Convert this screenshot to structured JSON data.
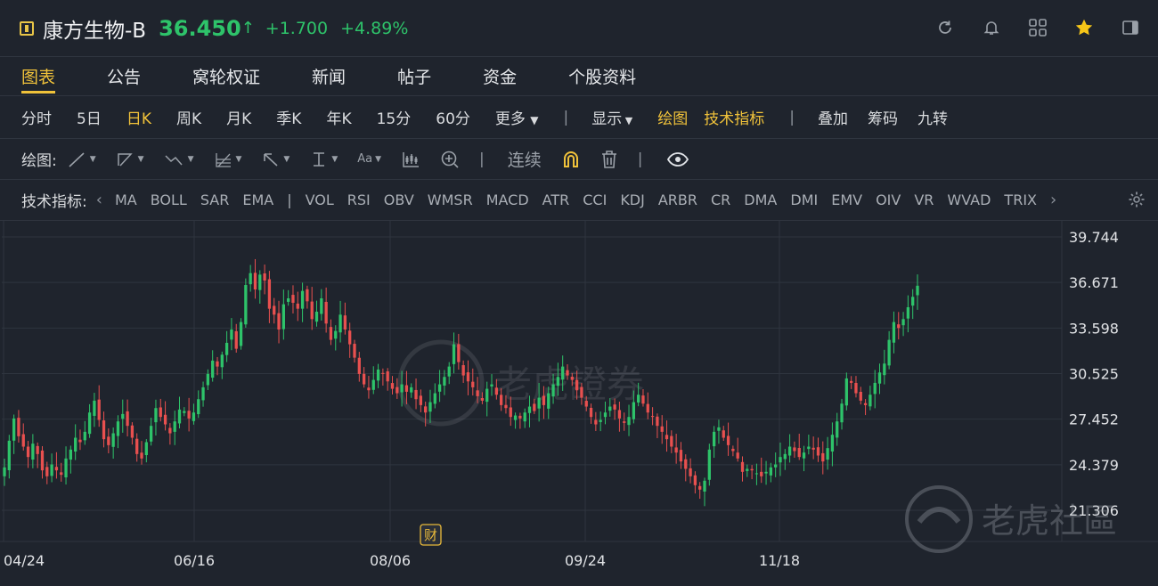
{
  "header": {
    "title": "康方生物-B",
    "price": "36.450",
    "arrow": "↑",
    "change": "+1.700",
    "change_pct": "+4.89%"
  },
  "tabs": [
    "图表",
    "公告",
    "窝轮权证",
    "新闻",
    "帖子",
    "资金",
    "个股资料"
  ],
  "periods": {
    "items": [
      "分时",
      "5日",
      "日K",
      "周K",
      "月K",
      "季K",
      "年K",
      "15分",
      "60分"
    ],
    "more": "更多",
    "display": "显示",
    "draw": "绘图",
    "indicators": "技术指标",
    "overlay": "叠加",
    "chips": "筹码",
    "nine": "九转"
  },
  "drawing": {
    "label": "绘图:",
    "continuous": "连续"
  },
  "indicators": {
    "label": "技术指标:",
    "items": [
      "MA",
      "BOLL",
      "SAR",
      "EMA",
      "|",
      "VOL",
      "RSI",
      "OBV",
      "WMSR",
      "MACD",
      "ATR",
      "CCI",
      "KDJ",
      "ARBR",
      "CR",
      "DMA",
      "DMI",
      "EMV",
      "OIV",
      "VR",
      "WVAD",
      "TRIX"
    ]
  },
  "watermark": {
    "center": "老虎證券",
    "corner": "老虎社區"
  },
  "marker": "财",
  "colors": {
    "up": "#2ec36a",
    "down": "#e8504f",
    "accent": "#f0c23a",
    "bg": "#1f242d"
  },
  "chart_data": {
    "type": "candlestick",
    "y_ticks": [
      "39.744",
      "36.671",
      "33.598",
      "30.525",
      "27.452",
      "24.379",
      "21.306"
    ],
    "x_ticks": [
      "04/24",
      "06/16",
      "08/06",
      "09/24",
      "11/18"
    ],
    "ylim": [
      21.306,
      39.744
    ],
    "closes": [
      24.2,
      26.0,
      27.5,
      26.3,
      25.6,
      24.9,
      25.8,
      25.1,
      24.0,
      23.6,
      24.4,
      24.0,
      23.7,
      24.8,
      25.4,
      26.2,
      25.9,
      26.6,
      27.9,
      28.7,
      27.4,
      26.1,
      25.7,
      26.5,
      27.3,
      27.8,
      27.0,
      26.2,
      25.1,
      24.8,
      25.9,
      27.0,
      28.2,
      27.6,
      27.1,
      26.5,
      27.3,
      28.1,
      28.0,
      27.5,
      27.9,
      28.8,
      29.6,
      30.5,
      31.4,
      31.0,
      31.8,
      32.6,
      33.5,
      32.2,
      34.0,
      36.5,
      37.3,
      36.2,
      37.2,
      36.8,
      34.9,
      34.5,
      33.5,
      35.2,
      35.6,
      35.3,
      34.9,
      36.1,
      35.4,
      34.2,
      34.7,
      35.6,
      33.9,
      32.8,
      33.4,
      34.5,
      33.5,
      32.5,
      31.6,
      30.5,
      29.8,
      29.4,
      30.1,
      30.8,
      30.5,
      30.0,
      29.5,
      29.2,
      29.8,
      29.3,
      29.6,
      28.8,
      28.4,
      27.9,
      28.6,
      29.2,
      29.8,
      30.3,
      31.0,
      32.5,
      31.3,
      30.4,
      30.0,
      29.6,
      29.0,
      28.7,
      29.5,
      29.8,
      29.1,
      28.4,
      28.2,
      27.6,
      27.7,
      27.5,
      27.9,
      28.3,
      28.0,
      28.9,
      28.4,
      29.2,
      29.8,
      30.3,
      31.0,
      30.4,
      30.1,
      29.4,
      28.9,
      28.3,
      27.6,
      27.1,
      27.4,
      27.9,
      28.3,
      28.1,
      27.5,
      27.2,
      27.6,
      28.6,
      29.1,
      28.5,
      27.9,
      27.6,
      27.0,
      26.6,
      26.1,
      25.6,
      25.2,
      24.6,
      24.1,
      23.6,
      23.0,
      22.7,
      23.3,
      25.4,
      26.6,
      26.9,
      26.2,
      25.7,
      25.3,
      24.8,
      23.9,
      24.1,
      24.0,
      23.8,
      23.6,
      23.9,
      24.2,
      24.4,
      24.9,
      25.1,
      25.6,
      25.3,
      24.9,
      25.2,
      25.6,
      25.4,
      25.0,
      24.6,
      25.5,
      26.4,
      27.3,
      28.5,
      30.2,
      29.9,
      29.2,
      28.7,
      28.4,
      29.1,
      29.9,
      30.6,
      31.2,
      32.8,
      34.0,
      33.6,
      34.2,
      35.0,
      35.7,
      36.45
    ],
    "events": [
      {
        "label": "财",
        "date": "08/06"
      }
    ]
  }
}
